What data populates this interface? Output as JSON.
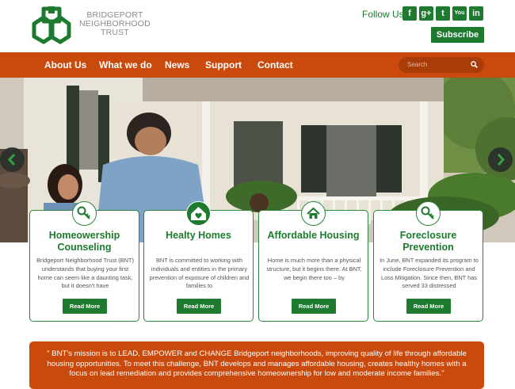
{
  "brand": {
    "name_line1": "BRIDGEPORT",
    "name_line2": "NEIGHBORHOOD",
    "name_line3": "TRUST",
    "green": "#1d7a2e",
    "orange": "#c94a0c"
  },
  "header": {
    "follow_label": "Follow Us",
    "social_icons": [
      "facebook-icon",
      "google-plus-icon",
      "twitter-icon",
      "youtube-icon",
      "linkedin-icon"
    ],
    "social_glyphs": [
      "f",
      "g+",
      "t",
      "You",
      "in"
    ],
    "subscribe_label": "Subscribe"
  },
  "nav": {
    "items": [
      "About Us",
      "What we do",
      "News",
      "Support",
      "Contact"
    ],
    "search_placeholder": "Search"
  },
  "cards": [
    {
      "title": "Homeowership Counseling",
      "icon": "key-icon",
      "text": "Bridgeport Neighborhood Trust (BNT) understands that buying your first home can seem like a daunting task, but it doesn't have",
      "button": "Read More"
    },
    {
      "title": "Healty Homes",
      "icon": "heart-house-icon",
      "text": "BNT is committed to working with individuals and entities in the primary prevention of exposure of children and families to",
      "button": "Read More"
    },
    {
      "title": "Affordable Housing",
      "icon": "home-icon",
      "text": "Home is much more than a physical structure, but it begins there. At BNT, we begin there too – by",
      "button": "Read More"
    },
    {
      "title": "Foreclosure Prevention",
      "icon": "key-icon",
      "text": "In June, BNT expanded its program to include Foreclosure Prevention and Loss Mitigation. Since then, BNT has served 33 distressed",
      "button": "Read More"
    }
  ],
  "mission": {
    "text": "\" BNT's mission is to LEAD, EMPOWER and CHANGE Bridgeport neighborhoods, improving quality of life through affordable housing opportunities. To meet this challenge, BNT develops and manages affordable housing, creates healthy homes with a focus on lead remediation and provides comprehensive homeownership for low and moderate income families.\""
  }
}
